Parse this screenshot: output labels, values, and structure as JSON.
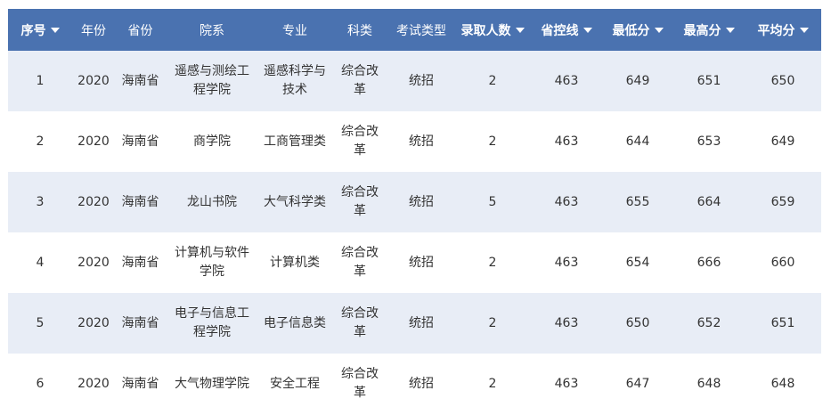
{
  "table": {
    "headers": [
      {
        "label": "序号",
        "sortable": true
      },
      {
        "label": "年份",
        "sortable": false
      },
      {
        "label": "省份",
        "sortable": false
      },
      {
        "label": "院系",
        "sortable": false
      },
      {
        "label": "专业",
        "sortable": false
      },
      {
        "label": "科类",
        "sortable": false
      },
      {
        "label": "考试类型",
        "sortable": false
      },
      {
        "label": "录取人数",
        "sortable": true
      },
      {
        "label": "省控线",
        "sortable": true
      },
      {
        "label": "最低分",
        "sortable": true
      },
      {
        "label": "最高分",
        "sortable": true
      },
      {
        "label": "平均分",
        "sortable": true
      }
    ],
    "rows": [
      [
        "1",
        "2020",
        "海南省",
        "遥感与测绘工程学院",
        "遥感科学与技术",
        "综合改革",
        "统招",
        "2",
        "463",
        "649",
        "651",
        "650"
      ],
      [
        "2",
        "2020",
        "海南省",
        "商学院",
        "工商管理类",
        "综合改革",
        "统招",
        "2",
        "463",
        "644",
        "653",
        "649"
      ],
      [
        "3",
        "2020",
        "海南省",
        "龙山书院",
        "大气科学类",
        "综合改革",
        "统招",
        "5",
        "463",
        "655",
        "664",
        "659"
      ],
      [
        "4",
        "2020",
        "海南省",
        "计算机与软件学院",
        "计算机类",
        "综合改革",
        "统招",
        "2",
        "463",
        "654",
        "666",
        "660"
      ],
      [
        "5",
        "2020",
        "海南省",
        "电子与信息工程学院",
        "电子信息类",
        "综合改革",
        "统招",
        "2",
        "463",
        "650",
        "652",
        "651"
      ],
      [
        "6",
        "2020",
        "海南省",
        "大气物理学院",
        "安全工程",
        "综合改革",
        "统招",
        "2",
        "463",
        "647",
        "648",
        "648"
      ]
    ]
  },
  "colors": {
    "header_bg": "#4a72b0",
    "row_alt_bg": "#e8edf6",
    "row_bg": "#ffffff",
    "text": "#333333"
  }
}
